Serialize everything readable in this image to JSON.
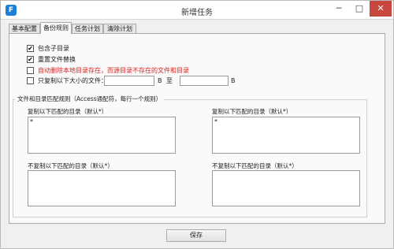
{
  "window": {
    "title": "新增任务",
    "app_icon": "F",
    "min_glyph": "─",
    "max_glyph": "□",
    "close_glyph": "✕"
  },
  "tabs": [
    {
      "label": "基本配置"
    },
    {
      "label": "备份规则"
    },
    {
      "label": "任务计划"
    },
    {
      "label": "清除计划"
    }
  ],
  "options": {
    "include_subdir": {
      "label": "包含子目录",
      "checked": true,
      "mark": "✔"
    },
    "overwrite_files": {
      "label": "重置文件替换",
      "checked": true,
      "mark": "✔"
    },
    "auto_delete": {
      "label": "自动删除本地目录存在，而源目录不存在的文件和目录",
      "checked": false,
      "mark": ""
    },
    "size_only": {
      "label": "只复制以下大小的文件：",
      "checked": false,
      "mark": "",
      "unit1": "B",
      "to": "至",
      "unit2": "B"
    }
  },
  "group": {
    "title": "文件和目录匹配规则（Access通配符，每行一个规则）",
    "copy_left_label": "复制以下匹配的目录（默认*）",
    "copy_left_value": "*",
    "copy_right_label": "复制以下匹配的目录（默认*）",
    "copy_right_value": "*",
    "nocopy_left_label": "不复制以下匹配的目录（默认*）",
    "nocopy_right_label": "不复制以下匹配的目录（默认*）"
  },
  "save_label": "保存",
  "colors": {
    "accent": "#1e7fd6",
    "close_red": "#c7463d",
    "warning_text": "#e02020"
  }
}
